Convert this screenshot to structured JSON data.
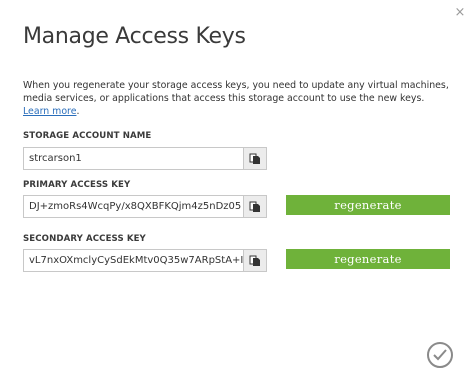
{
  "dialog": {
    "close_glyph": "×",
    "title": "Manage Access Keys",
    "description": "When you regenerate your storage access keys, you need to update any virtual machines, media services, or applications that access this storage account to use the new keys.",
    "learn_more": "Learn more",
    "description_end": "."
  },
  "storage_account": {
    "label": "STORAGE ACCOUNT NAME",
    "value": "strcarson1"
  },
  "primary_key": {
    "label": "PRIMARY ACCESS KEY",
    "value": "DJ+zmoRs4WcqPy/x8QXBFKQjm4z5nDz05",
    "regenerate_label": "regenerate"
  },
  "secondary_key": {
    "label": "SECONDARY ACCESS KEY",
    "value": "vL7nxOXmclyCySdEkMtv0Q35w7ARpStA+I",
    "regenerate_label": "regenerate"
  },
  "colors": {
    "accent_green": "#6fb23a",
    "link_blue": "#2a6ebb"
  },
  "icons": {
    "close": "close-icon",
    "copy": "copy-icon",
    "ok": "checkmark-icon"
  }
}
